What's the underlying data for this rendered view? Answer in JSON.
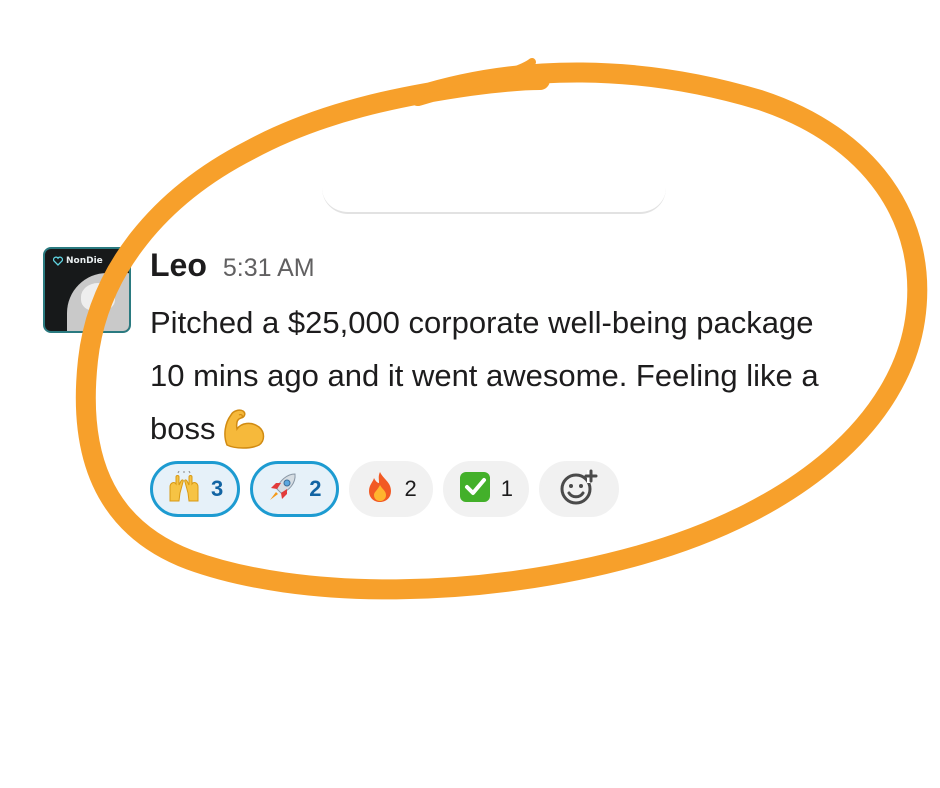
{
  "message": {
    "author": "Leo",
    "time": "5:31 AM",
    "avatar_brand": "NonDie",
    "body_lines": [
      "Pitched a $25,000 corporate well-being package",
      "10 mins ago and it went awesome. Feeling like a",
      "boss"
    ],
    "trailing_emoji": "flexed-biceps-icon"
  },
  "reactions": [
    {
      "emoji": "raising-hands-icon",
      "count": "3",
      "selected": true
    },
    {
      "emoji": "rocket-icon",
      "count": "2",
      "selected": true
    },
    {
      "emoji": "fire-icon",
      "count": "2",
      "selected": false
    },
    {
      "emoji": "check-mark-button-icon",
      "count": "1",
      "selected": false
    }
  ],
  "add_reaction": {
    "icon": "add-reaction-icon"
  },
  "colors": {
    "annotation": "#f7a02b",
    "selected_border": "#1d9bd1",
    "selected_bg": "#e6f1f9",
    "selected_text": "#1264a3",
    "chip_bg": "#f1f1f1"
  }
}
